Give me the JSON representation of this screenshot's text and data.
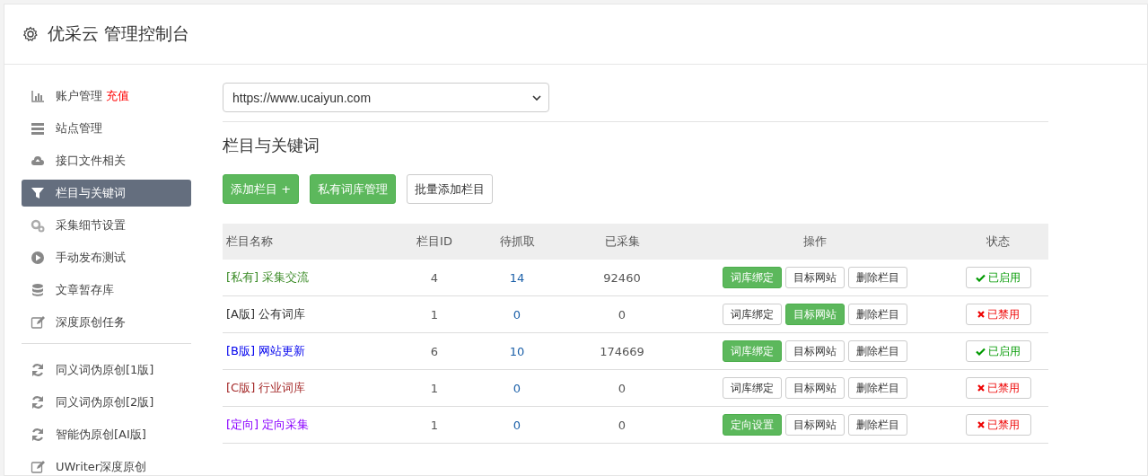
{
  "header": {
    "title": "优采云 管理控制台"
  },
  "sidebar": {
    "groups": [
      {
        "items": [
          {
            "label": "账户管理",
            "badge": "充值",
            "selected": false
          },
          {
            "label": "站点管理",
            "selected": false
          },
          {
            "label": "接口文件相关",
            "selected": false
          },
          {
            "label": "栏目与关键词",
            "selected": true
          },
          {
            "label": "采集细节设置",
            "selected": false
          },
          {
            "label": "手动发布测试",
            "selected": false
          },
          {
            "label": "文章暂存库",
            "selected": false
          },
          {
            "label": "深度原创任务",
            "selected": false
          }
        ]
      },
      {
        "items": [
          {
            "label": "同义词伪原创[1版]",
            "selected": false
          },
          {
            "label": "同义词伪原创[2版]",
            "selected": false
          },
          {
            "label": "智能伪原创[AI版]",
            "selected": false
          },
          {
            "label": "UWriter深度原创",
            "selected": false
          }
        ]
      }
    ]
  },
  "site_select": {
    "value": "https://www.ucaiyun.com"
  },
  "section_title": "栏目与关键词",
  "toolbar": [
    {
      "label": "添加栏目 +",
      "primary": true
    },
    {
      "label": "私有词库管理",
      "primary": true
    },
    {
      "label": "批量添加栏目",
      "primary": false
    }
  ],
  "table": {
    "columns": [
      "栏目名称",
      "栏目ID",
      "待抓取",
      "已采集",
      "操作",
      "状态"
    ],
    "rows": [
      {
        "tag": "[私有]",
        "name": "采集交流",
        "color": "#3c8c28",
        "id": "4",
        "pending": "14",
        "collected": "92460",
        "actions": [
          {
            "label": "词库绑定",
            "active": true
          },
          {
            "label": "目标网站",
            "active": false
          },
          {
            "label": "删除栏目",
            "active": false
          }
        ],
        "status": "已启用",
        "enabled": true
      },
      {
        "tag": "[A版]",
        "name": "公有词库",
        "color": "#333333",
        "id": "1",
        "pending": "0",
        "collected": "0",
        "actions": [
          {
            "label": "词库绑定",
            "active": false
          },
          {
            "label": "目标网站",
            "active": true
          },
          {
            "label": "删除栏目",
            "active": false
          }
        ],
        "status": "已禁用",
        "enabled": false
      },
      {
        "tag": "[B版]",
        "name": "网站更新",
        "color": "#0000ee",
        "id": "6",
        "pending": "10",
        "collected": "174669",
        "actions": [
          {
            "label": "词库绑定",
            "active": true
          },
          {
            "label": "目标网站",
            "active": false
          },
          {
            "label": "删除栏目",
            "active": false
          }
        ],
        "status": "已启用",
        "enabled": true
      },
      {
        "tag": "[C版]",
        "name": "行业词库",
        "color": "#a52a2a",
        "id": "1",
        "pending": "0",
        "collected": "0",
        "actions": [
          {
            "label": "词库绑定",
            "active": false
          },
          {
            "label": "目标网站",
            "active": false
          },
          {
            "label": "删除栏目",
            "active": false
          }
        ],
        "status": "已禁用",
        "enabled": false
      },
      {
        "tag": "[定向]",
        "name": "定向采集",
        "color": "#8a00ff",
        "id": "1",
        "pending": "0",
        "collected": "0",
        "actions": [
          {
            "label": "定向设置",
            "active": true
          },
          {
            "label": "目标网站",
            "active": false
          },
          {
            "label": "删除栏目",
            "active": false
          }
        ],
        "status": "已禁用",
        "enabled": false
      }
    ]
  }
}
